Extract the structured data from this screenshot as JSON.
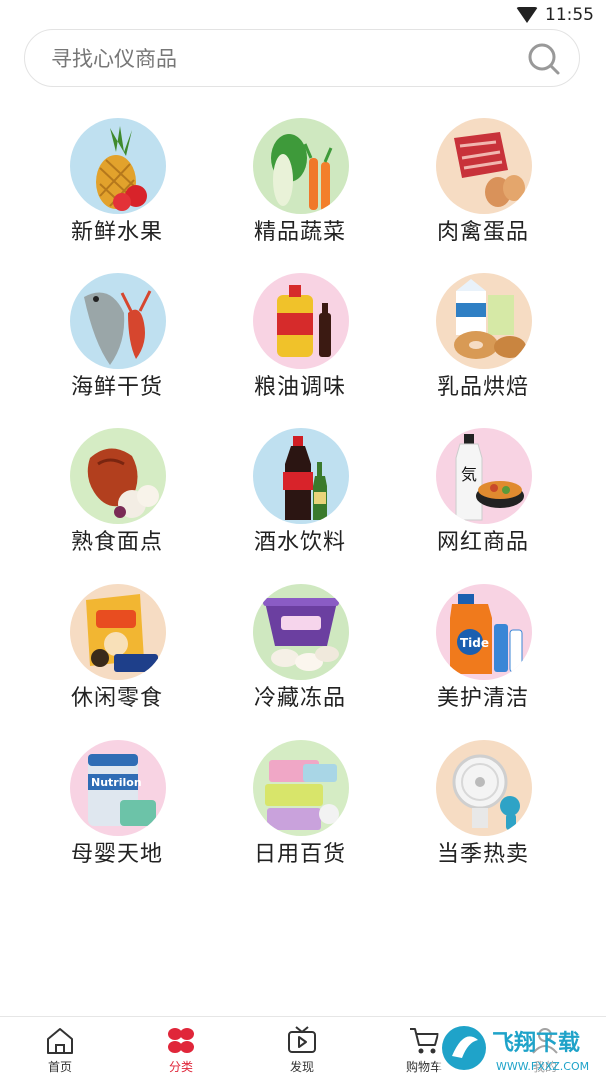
{
  "status": {
    "time": "11:55"
  },
  "search": {
    "placeholder": "寻找心仪商品"
  },
  "categories": [
    {
      "label": "新鲜水果"
    },
    {
      "label": "精品蔬菜"
    },
    {
      "label": "肉禽蛋品"
    },
    {
      "label": "海鲜干货"
    },
    {
      "label": "粮油调味"
    },
    {
      "label": "乳品烘焙"
    },
    {
      "label": "熟食面点"
    },
    {
      "label": "酒水饮料"
    },
    {
      "label": "网红商品"
    },
    {
      "label": "休闲零食"
    },
    {
      "label": "冷藏冻品"
    },
    {
      "label": "美护清洁"
    },
    {
      "label": "母婴天地"
    },
    {
      "label": "日用百货"
    },
    {
      "label": "当季热卖"
    }
  ],
  "tabs": [
    {
      "label": "首页",
      "icon": "home-icon"
    },
    {
      "label": "分类",
      "icon": "category-icon",
      "active": true
    },
    {
      "label": "发现",
      "icon": "discover-icon"
    },
    {
      "label": "购物车",
      "icon": "cart-icon"
    },
    {
      "label": "我的",
      "icon": "profile-icon"
    }
  ],
  "watermark": {
    "text": "飞翔下载",
    "url": "WWW.FXXZ.COM"
  },
  "colors": {
    "accent": "#e0263a",
    "text": "#222222",
    "border": "#e3e3e3"
  }
}
